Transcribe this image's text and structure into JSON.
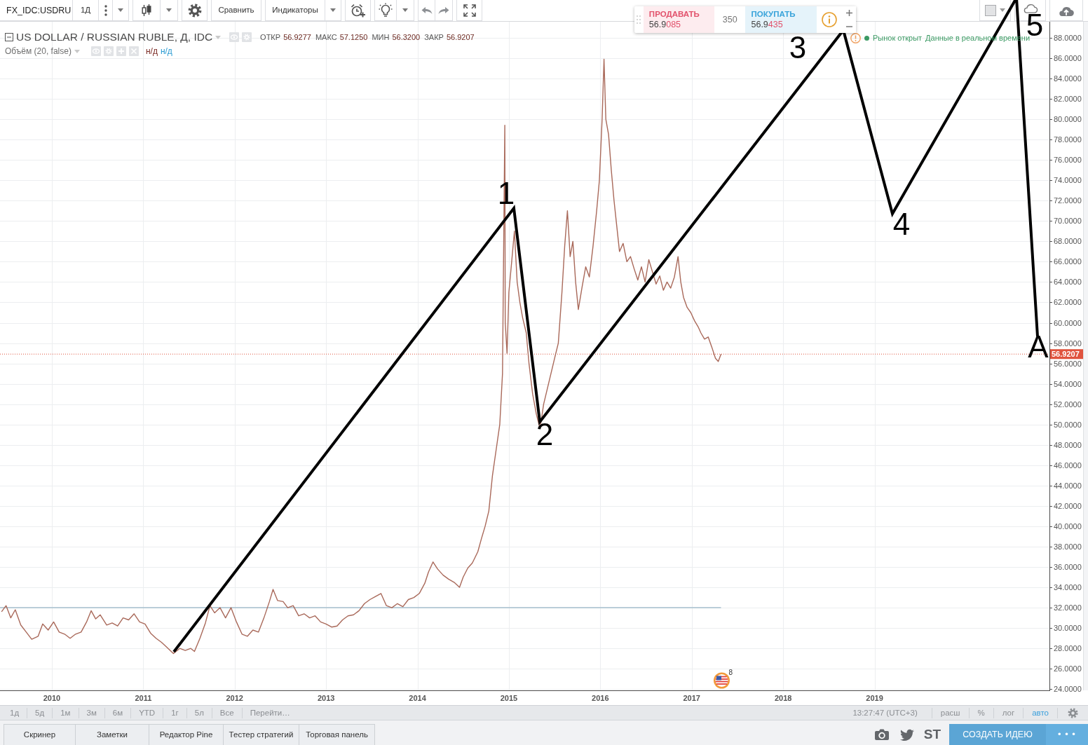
{
  "toolbar": {
    "symbol": "FX_IDC:USDRU",
    "interval": "1Д",
    "compare": "Сравнить",
    "indicators": "Индикаторы"
  },
  "trade_panel": {
    "sell": {
      "label": "ПРОДАВАТЬ",
      "price_main": "56.9",
      "price_pips": "085"
    },
    "spread": "350",
    "buy": {
      "label": "ПОКУПАТЬ",
      "price_main": "56.9",
      "price_pips": "435"
    }
  },
  "legend": {
    "ohlc": [
      {
        "label": "ОТКР",
        "value": "56.9277"
      },
      {
        "label": "МАКС",
        "value": "57.1250"
      },
      {
        "label": "МИН",
        "value": "56.3200"
      },
      {
        "label": "ЗАКР",
        "value": "56.9207"
      }
    ],
    "volume": {
      "title": "Объём (20, false)",
      "values": [
        {
          "text": "н/д",
          "color": "#7b2b25"
        },
        {
          "text": "н/д",
          "color": "#2a9bd2"
        }
      ]
    }
  },
  "market_status": {
    "status": "Рынок открыт",
    "data_mode": "Данные в реальном времени"
  },
  "chart": {
    "chart_data": {
      "type": "line",
      "x": [
        2009.45,
        2009.5,
        2009.55,
        2009.6,
        2009.66,
        2009.72,
        2009.78,
        2009.85,
        2009.9,
        2009.96,
        2010.02,
        2010.08,
        2010.14,
        2010.2,
        2010.26,
        2010.32,
        2010.38,
        2010.43,
        2010.48,
        2010.53,
        2010.6,
        2010.66,
        2010.72,
        2010.78,
        2010.84,
        2010.9,
        2010.96,
        2011.02,
        2011.08,
        2011.14,
        2011.2,
        2011.26,
        2011.33,
        2011.4,
        2011.46,
        2011.52,
        2011.56,
        2011.62,
        2011.68,
        2011.73,
        2011.78,
        2011.84,
        2011.9,
        2011.96,
        2012.02,
        2012.08,
        2012.14,
        2012.2,
        2012.26,
        2012.32,
        2012.38,
        2012.42,
        2012.47,
        2012.53,
        2012.58,
        2012.64,
        2012.7,
        2012.76,
        2012.82,
        2012.88,
        2012.94,
        2013.0,
        2013.06,
        2013.12,
        2013.18,
        2013.24,
        2013.3,
        2013.36,
        2013.42,
        2013.48,
        2013.54,
        2013.6,
        2013.66,
        2013.72,
        2013.78,
        2013.84,
        2013.9,
        2013.96,
        2014.02,
        2014.08,
        2014.12,
        2014.17,
        2014.22,
        2014.28,
        2014.34,
        2014.4,
        2014.46,
        2014.5,
        2014.55,
        2014.6,
        2014.66,
        2014.7,
        2014.74,
        2014.78,
        2014.82,
        2014.86,
        2014.9,
        2014.93,
        2014.955,
        2014.96,
        2014.98,
        2015.0,
        2015.03,
        2015.06,
        2015.09,
        2015.12,
        2015.15,
        2015.19,
        2015.22,
        2015.26,
        2015.3,
        2015.34,
        2015.38,
        2015.42,
        2015.46,
        2015.5,
        2015.54,
        2015.58,
        2015.61,
        2015.64,
        2015.67,
        2015.7,
        2015.73,
        2015.76,
        2015.8,
        2015.84,
        2015.88,
        2015.92,
        2015.96,
        2015.99,
        2016.02,
        2016.04,
        2016.06,
        2016.09,
        2016.12,
        2016.15,
        2016.18,
        2016.21,
        2016.25,
        2016.29,
        2016.33,
        2016.37,
        2016.41,
        2016.45,
        2016.49,
        2016.53,
        2016.57,
        2016.61,
        2016.65,
        2016.69,
        2016.73,
        2016.77,
        2016.81,
        2016.85,
        2016.88,
        2016.91,
        2016.95,
        2016.99,
        2017.03,
        2017.07,
        2017.1,
        2017.14,
        2017.18,
        2017.22,
        2017.26,
        2017.29,
        2017.32
      ],
      "series": [
        {
          "name": "US DOLLAR / RUSSIAN RUBLE, Д, IDC",
          "color": "#a9695a",
          "values": [
            31.6,
            32.2,
            31.0,
            31.8,
            30.3,
            29.6,
            28.9,
            29.2,
            30.4,
            29.8,
            30.6,
            29.6,
            29.4,
            29.0,
            29.4,
            29.6,
            30.6,
            31.7,
            30.9,
            31.3,
            30.3,
            30.5,
            30.2,
            31.0,
            30.8,
            31.4,
            30.6,
            30.4,
            29.5,
            29.0,
            28.6,
            28.1,
            27.5,
            28.0,
            27.8,
            28.0,
            27.7,
            29.0,
            30.5,
            32.2,
            31.5,
            32.0,
            31.0,
            32.0,
            30.6,
            29.4,
            29.2,
            29.8,
            29.6,
            31.0,
            32.6,
            33.8,
            32.7,
            32.6,
            32.0,
            32.2,
            31.2,
            31.4,
            31.0,
            31.2,
            30.6,
            30.4,
            30.1,
            30.2,
            30.8,
            31.2,
            31.3,
            31.7,
            32.4,
            32.8,
            33.1,
            33.4,
            32.2,
            32.0,
            32.4,
            32.1,
            32.8,
            33.0,
            33.4,
            34.4,
            35.5,
            36.5,
            35.8,
            35.2,
            34.8,
            34.5,
            34.0,
            35.0,
            35.9,
            36.4,
            37.5,
            38.8,
            40.0,
            41.5,
            45.0,
            47.5,
            50.0,
            55.0,
            79.4,
            60.0,
            57.0,
            63.0,
            66.0,
            69.0,
            64.0,
            62.0,
            60.5,
            59.0,
            56.0,
            53.0,
            51.0,
            49.6,
            52.0,
            53.5,
            55.0,
            56.5,
            58.0,
            63.0,
            67.5,
            71.0,
            66.5,
            68.0,
            64.0,
            61.3,
            63.5,
            65.5,
            64.5,
            67.5,
            71.0,
            74.0,
            80.0,
            85.9,
            80.0,
            78.5,
            75.0,
            72.0,
            69.5,
            67.0,
            67.8,
            66.0,
            66.5,
            65.3,
            64.2,
            65.5,
            64.0,
            66.2,
            65.0,
            63.8,
            64.6,
            63.2,
            64.0,
            63.4,
            64.5,
            66.5,
            64.0,
            62.5,
            61.5,
            61.0,
            60.2,
            59.6,
            59.0,
            58.4,
            58.6,
            57.6,
            56.5,
            56.2,
            56.92
          ]
        }
      ],
      "xlim": [
        2009.433,
        2020.913
      ],
      "ylim": [
        23.88,
        89.58
      ],
      "xticks": [
        2010,
        2011,
        2012,
        2013,
        2014,
        2015,
        2016,
        2017,
        2018,
        2019
      ],
      "yticks": [
        {
          "value": 24,
          "label": "24.0000"
        },
        {
          "value": 26,
          "label": "26.0000"
        },
        {
          "value": 28,
          "label": "28.0000"
        },
        {
          "value": 30,
          "label": "30.0000"
        },
        {
          "value": 32,
          "label": "32.0000"
        },
        {
          "value": 34,
          "label": "34.0000"
        },
        {
          "value": 36,
          "label": "36.0000"
        },
        {
          "value": 38,
          "label": "38.0000"
        },
        {
          "value": 40,
          "label": "40.0000"
        },
        {
          "value": 42,
          "label": "42.0000"
        },
        {
          "value": 44,
          "label": "44.0000"
        },
        {
          "value": 46,
          "label": "46.0000"
        },
        {
          "value": 48,
          "label": "48.0000"
        },
        {
          "value": 50,
          "label": "50.0000"
        },
        {
          "value": 52,
          "label": "52.0000"
        },
        {
          "value": 54,
          "label": "54.0000"
        },
        {
          "value": 56,
          "label": "56.0000"
        },
        {
          "value": 58,
          "label": "58.0000"
        },
        {
          "value": 60,
          "label": "60.0000"
        },
        {
          "value": 62,
          "label": "62.0000"
        },
        {
          "value": 64,
          "label": "64.0000"
        },
        {
          "value": 66,
          "label": "66.0000"
        },
        {
          "value": 68,
          "label": "68.0000"
        },
        {
          "value": 70,
          "label": "70.0000"
        },
        {
          "value": 72,
          "label": "72.0000"
        },
        {
          "value": 74,
          "label": "74.0000"
        },
        {
          "value": 76,
          "label": "76.0000"
        },
        {
          "value": 78,
          "label": "78.0000"
        },
        {
          "value": 80,
          "label": "80.0000"
        },
        {
          "value": 82,
          "label": "82.0000"
        },
        {
          "value": 84,
          "label": "84.0000"
        },
        {
          "value": 86,
          "label": "86.0000"
        },
        {
          "value": 88,
          "label": "88.0000"
        }
      ],
      "grid": true,
      "ref_lines": [
        {
          "axis": "y",
          "value": 32,
          "color": "#a6bfce"
        },
        {
          "axis": "y",
          "value": 56.9207,
          "color": "#e0533e",
          "label": "56.9207"
        }
      ]
    },
    "wave_labels": [
      "1",
      "2",
      "3",
      "4",
      "5",
      "A"
    ],
    "event_marker": {
      "count": "8"
    }
  },
  "range_bar": {
    "ranges": [
      "1д",
      "5д",
      "1м",
      "3м",
      "6м",
      "YTD",
      "1г",
      "5л",
      "Все"
    ],
    "goto": "Перейти…",
    "clock": "13:27:47 (UTC+3)",
    "scale_options": [
      {
        "label": "расш",
        "on": false
      },
      {
        "label": "%",
        "on": false
      },
      {
        "label": "лог",
        "on": false
      },
      {
        "label": "авто",
        "on": true
      }
    ]
  },
  "bottom_panel": {
    "tabs": [
      "Скринер",
      "Заметки",
      "Редактор Pine",
      "Тестер стратегий",
      "Торговая панель"
    ],
    "share_text": "ST",
    "create_idea": "СОЗДАТЬ ИДЕЮ",
    "more": "• • •"
  }
}
